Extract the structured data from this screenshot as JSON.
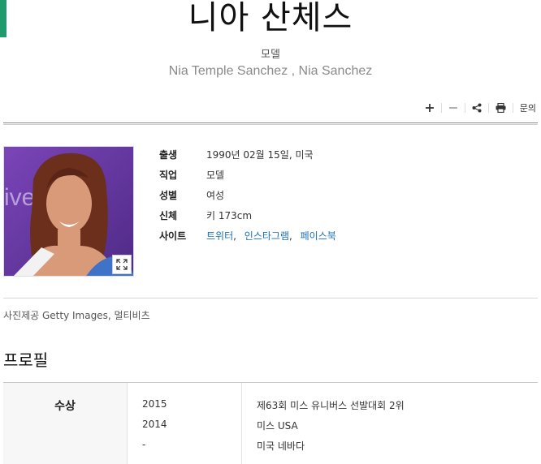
{
  "header": {
    "title": "니아 산체스",
    "occupation": "모델",
    "english_name": "Nia Temple Sanchez , Nia Sanchez"
  },
  "toolbar": {
    "add_icon": "plus-icon",
    "shrink_icon": "minus-icon",
    "share_icon": "share-icon",
    "print_icon": "print-icon",
    "inquiry_label": "문의"
  },
  "info": [
    {
      "key": "출생",
      "value": "1990년 02월 15일, 미국"
    },
    {
      "key": "직업",
      "value": "모델"
    },
    {
      "key": "성별",
      "value": "여성"
    },
    {
      "key": "신체",
      "value": "키 173cm"
    },
    {
      "key": "사이트",
      "links": [
        "트위터",
        "인스타그램",
        "페이스북"
      ]
    }
  ],
  "photo_credit": "사진제공  Getty Images, 멀티비츠",
  "profile": {
    "section_title": "프로필",
    "awards_label": "수상",
    "awards": [
      {
        "year": "2015",
        "title": "제63회 미스 유니버스 선발대회 2위"
      },
      {
        "year": "2014",
        "title": "미스 USA"
      },
      {
        "year": "-",
        "title": "미국 네바다"
      }
    ]
  },
  "colors": {
    "accent": "#1f9a6b",
    "link": "#1a6fb4",
    "photo_background": "#6a3aa0"
  }
}
